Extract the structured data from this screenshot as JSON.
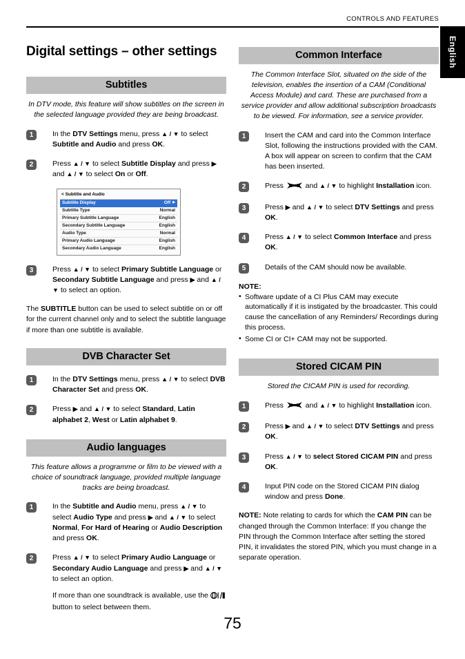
{
  "header": {
    "running_head": "CONTROLS AND FEATURES",
    "language_tab": "English"
  },
  "page_title": "Digital settings – other settings",
  "page_number": "75",
  "left_column": {
    "subtitles": {
      "heading": "Subtitles",
      "intro": "In DTV mode, this feature will show subtitles on the screen in the selected language provided they are being broadcast.",
      "step1_num": "1",
      "step1_a": "In the ",
      "step1_b1": "DTV Settings",
      "step1_c": " menu, press ",
      "step1_arrows": "▲ / ▼",
      "step1_d": " to select ",
      "step1_b2": "Subtitle and Audio",
      "step1_e": " and press ",
      "step1_b3": "OK",
      "step1_f": ".",
      "step2_num": "2",
      "step2_a": "Press ",
      "step2_arrows1": "▲ / ▼",
      "step2_b": " to select ",
      "step2_bold1": "Subtitle Display",
      "step2_c": " and press ",
      "step2_arrow_right": "▶",
      "step2_d": " and ",
      "step2_arrows2": "▲ / ▼",
      "step2_e": " to select ",
      "step2_bold2": "On",
      "step2_f": " or ",
      "step2_bold3": "Off",
      "step2_g": ".",
      "step3_num": "3",
      "step3_a": "Press ",
      "step3_arrows1": "▲ / ▼",
      "step3_b": " to select ",
      "step3_bold1": "Primary Subtitle Language",
      "step3_c": " or ",
      "step3_bold2": "Secondary Subtitle Language",
      "step3_d": " and press ",
      "step3_arrow_right": "▶",
      "step3_e": " and ",
      "step3_arrows2": "▲ / ▼",
      "step3_f": " to select an option.",
      "closing_a": "The ",
      "closing_bold": "SUBTITLE",
      "closing_b": " button can be used to select subtitle on or off for the current channel only and to select the subtitle language if more than one subtitle is available."
    },
    "tv_menu": {
      "title": "< Subtitle and Audio",
      "rows": [
        {
          "label": "Subtitle Display",
          "value": "Off",
          "selected": true,
          "caret": "▶"
        },
        {
          "label": "Subtitle Type",
          "value": "Normal",
          "selected": false,
          "caret": ""
        },
        {
          "label": "Primary Subtitle Language",
          "value": "English",
          "selected": false,
          "caret": ""
        },
        {
          "label": "Secondary Subtitle Language",
          "value": "English",
          "selected": false,
          "caret": ""
        },
        {
          "label": "Audio Type",
          "value": "Normal",
          "selected": false,
          "caret": ""
        },
        {
          "label": "Primary Audio Language",
          "value": "English",
          "selected": false,
          "caret": ""
        },
        {
          "label": "Secondary Audio Language",
          "value": "English",
          "selected": false,
          "caret": ""
        }
      ]
    },
    "dvb_character_set": {
      "heading": "DVB Character Set",
      "step1_num": "1",
      "step1_a": "In the ",
      "step1_bold1": "DTV Settings",
      "step1_b": " menu, press ",
      "step1_arrows": "▲ / ▼",
      "step1_c": " to select ",
      "step1_bold2": "DVB Character Set",
      "step1_d": " and press ",
      "step1_bold3": "OK",
      "step1_e": ".",
      "step2_num": "2",
      "step2_a": "Press ",
      "step2_arrow_right": "▶",
      "step2_b": " and ",
      "step2_arrows": "▲ / ▼",
      "step2_c": " to select ",
      "step2_bold1": "Standard",
      "step2_d": ", ",
      "step2_bold2": "Latin alphabet 2",
      "step2_e": ", ",
      "step2_bold3": "West",
      "step2_f": " or ",
      "step2_bold4": "Latin alphabet 9",
      "step2_g": "."
    },
    "audio_languages": {
      "heading": "Audio languages",
      "intro": "This feature allows a programme or film to be viewed with a choice of soundtrack language, provided multiple language tracks are being broadcast.",
      "step1_num": "1",
      "step1_a": "In the ",
      "step1_bold1": "Subtitle and Audio",
      "step1_b": " menu, press ",
      "step1_arrows1": "▲ / ▼",
      "step1_c": " to select ",
      "step1_bold2": "Audio Type",
      "step1_d": " and press ",
      "step1_arrow_right": "▶",
      "step1_e": " and ",
      "step1_arrows2": "▲ / ▼",
      "step1_f": " to select ",
      "step1_bold3": "Normal",
      "step1_g": ", ",
      "step1_bold4": "For Hard of Hearing",
      "step1_h": " or ",
      "step1_bold5": "Audio Description",
      "step1_i": " and press ",
      "step1_bold6": "OK",
      "step1_j": ".",
      "step2_num": "2",
      "step2_a": "Press ",
      "step2_arrows1": "▲ / ▼",
      "step2_b": " to select ",
      "step2_bold1": "Primary Audio Language",
      "step2_c": " or ",
      "step2_bold2": "Secondary Audio Language",
      "step2_d": " and press ",
      "step2_arrow_right": "▶",
      "step2_e": " and ",
      "step2_arrows2": "▲ / ▼",
      "step2_f": " to select an option.",
      "step2_para_a": "If more than one soundtrack is available, use the ",
      "step2_para_b": " button to select between them."
    }
  },
  "right_column": {
    "common_interface": {
      "heading": "Common Interface",
      "intro": "The Common Interface Slot, situated on the side of the television, enables the insertion of a CAM (Conditional Access Module) and card. These are purchased from a service provider and allow additional subscription broadcasts to be viewed. For information, see a service provider.",
      "step1_num": "1",
      "step1_text": "Insert the CAM and card into the Common Interface Slot, following the instructions provided with the CAM. A box will appear on screen to confirm that the CAM has been inserted.",
      "step2_num": "2",
      "step2_a": "Press ",
      "step2_b": " and ",
      "step2_arrows": "▲ / ▼",
      "step2_c": " to highlight ",
      "step2_bold": "Installation",
      "step2_d": " icon.",
      "step3_num": "3",
      "step3_a": "Press ",
      "step3_arrow_right": "▶",
      "step3_b": " and ",
      "step3_arrows": "▲ / ▼",
      "step3_c": " to select ",
      "step3_bold1": "DTV Settings",
      "step3_d": " and press ",
      "step3_bold2": "OK",
      "step3_e": ".",
      "step4_num": "4",
      "step4_a": "Press ",
      "step4_arrows": "▲ / ▼",
      "step4_b": " to select ",
      "step4_bold1": "Common Interface",
      "step4_c": " and press ",
      "step4_bold2": "OK",
      "step4_d": ".",
      "step5_num": "5",
      "step5_text": "Details of the CAM should now be available.",
      "note_title": "NOTE:",
      "notes": [
        "Software update of a CI Plus CAM may execute automatically if it is instigated by the broadcaster. This could cause the cancellation of any Reminders/ Recordings during this process.",
        "Some CI or CI+ CAM may not be supported."
      ]
    },
    "stored_cicam_pin": {
      "heading": "Stored CICAM PIN",
      "intro": "Stored the CICAM PIN is used for recording.",
      "step1_num": "1",
      "step1_a": "Press ",
      "step1_b": " and ",
      "step1_arrows": "▲ / ▼",
      "step1_c": " to highlight ",
      "step1_bold": "Installation",
      "step1_d": " icon.",
      "step2_num": "2",
      "step2_a": "Press ",
      "step2_arrow_right": "▶",
      "step2_b": " and ",
      "step2_arrows": "▲ / ▼",
      "step2_c": " to select ",
      "step2_bold1": "DTV Settings",
      "step2_d": " and press ",
      "step2_bold2": "OK",
      "step2_e": ".",
      "step3_num": "3",
      "step3_a": "Press ",
      "step3_arrows": "▲ / ▼",
      "step3_b": " to ",
      "step3_bold1": "select Stored CICAM PIN",
      "step3_c": " and press ",
      "step3_bold2": "OK",
      "step3_d": ".",
      "step4_num": "4",
      "step4_a": "Input PIN code on the Stored CICAM PIN dialog window and press ",
      "step4_bold": "Done",
      "step4_b": ".",
      "note_bold": "NOTE:",
      "note_a": " Note relating to cards for which the ",
      "note_bold2": "CAM PIN",
      "note_b": " can be changed through the Common Interface: If you change the PIN through the Common Interface after setting the stored PIN, it invalidates the stored PIN, which you must change in a separate operation."
    }
  },
  "colors": {
    "band_gray": "#bfbfbf",
    "step_badge": "#595959",
    "menu_highlight": "#2f6fd0",
    "tab_black": "#000000"
  }
}
